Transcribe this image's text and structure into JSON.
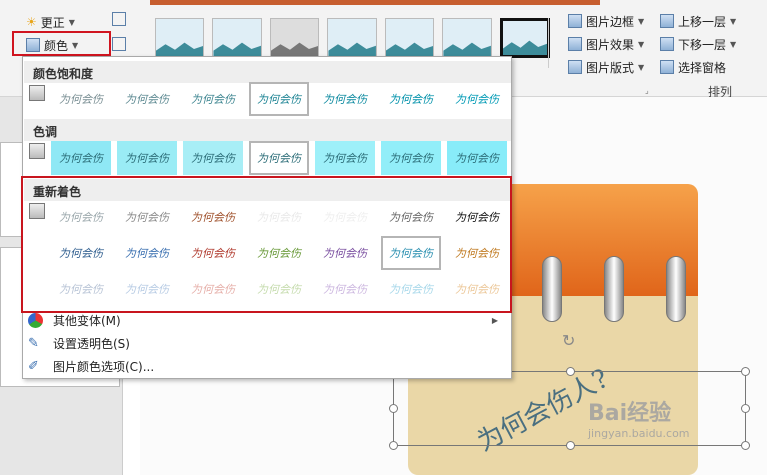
{
  "ribbon": {
    "update_label": "更正",
    "color_label": "颜色",
    "picture_border": "图片边框",
    "picture_effects": "图片效果",
    "picture_layout": "图片版式",
    "bring_forward": "上移一层",
    "send_backward": "下移一层",
    "selection_pane": "选择窗格",
    "arrange_group": "排列"
  },
  "dropdown": {
    "saturation_title": "颜色饱和度",
    "tone_title": "色调",
    "recolor_title": "重新着色",
    "swatch_text": "为何会伤",
    "more_variations": "其他变体(M)",
    "set_transparent": "设置透明色(S)",
    "picture_color_options": "图片颜色选项(C)..."
  },
  "slide": {
    "note_text": "为何会伤人?",
    "watermark_main": "Bai经验",
    "watermark_sub": "jingyan.baidu.com"
  },
  "colors": {
    "highlight_red": "#d0141f",
    "tone_cyan": "#8fe8f5",
    "ribbon_bg": "#f3f3f3"
  }
}
